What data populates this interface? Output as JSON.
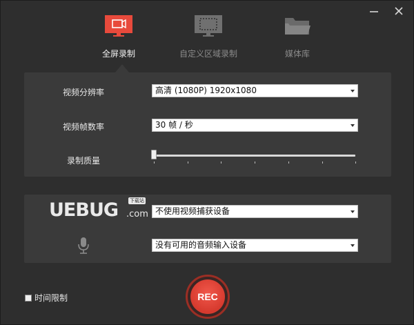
{
  "window": {
    "minimize_icon": "minimize-icon",
    "close_icon": "close-icon"
  },
  "tabs": [
    {
      "label": "全屏录制",
      "icon": "fullscreen-record-icon",
      "active": true
    },
    {
      "label": "自定义区域录制",
      "icon": "region-record-icon",
      "active": false
    },
    {
      "label": "媒体库",
      "icon": "folder-icon",
      "active": false
    }
  ],
  "video_settings": {
    "resolution_label": "视频分辨率",
    "resolution_value": "高清 (1080P)   1920x1080",
    "framerate_label": "视频帧数率",
    "framerate_value": "30 帧 / 秒",
    "quality_label": "录制质量",
    "quality_level": 0
  },
  "capture": {
    "logo_text": "UEBUG",
    "logo_suffix": ".com",
    "logo_badge": "下载站",
    "camera_value": "不使用视频捕获设备",
    "audio_value": "没有可用的音频输入设备",
    "mic_icon": "microphone-icon"
  },
  "footer": {
    "time_limit_label": "时间限制",
    "time_limit_checked": false,
    "rec_label": "REC"
  },
  "colors": {
    "accent": "#e84a3c",
    "background": "#2e2e2e",
    "panel": "#3a3a3a"
  }
}
